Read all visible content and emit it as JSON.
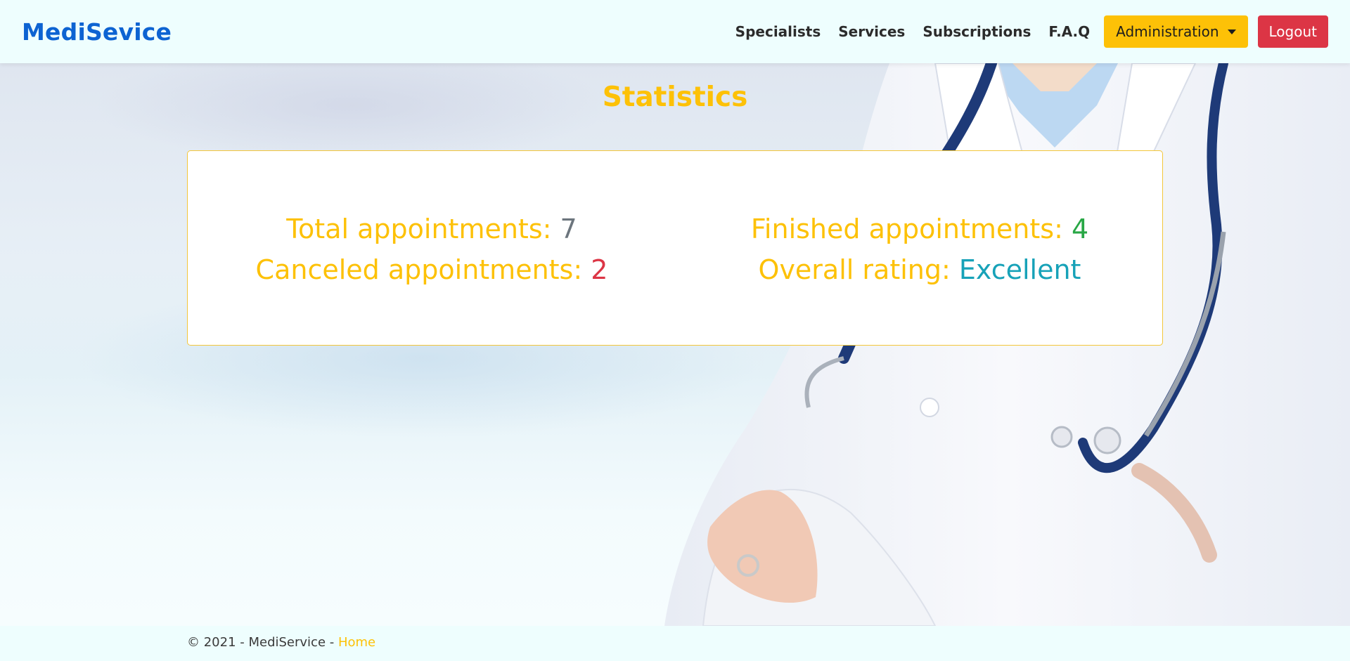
{
  "brand": {
    "name": "MediSevice"
  },
  "nav": {
    "links": [
      "Specialists",
      "Services",
      "Subscriptions",
      "F.A.Q"
    ],
    "admin_label": "Administration",
    "logout_label": "Logout"
  },
  "page": {
    "title": "Statistics"
  },
  "stats": {
    "total_label": "Total appointments: ",
    "total_value": "7",
    "canceled_label": "Canceled appointments: ",
    "canceled_value": "2",
    "finished_label": "Finished appointments: ",
    "finished_value": "4",
    "rating_label": "Overall rating: ",
    "rating_value": "Excellent"
  },
  "footer": {
    "text": "© 2021 - MediService - ",
    "link": "Home"
  },
  "colors": {
    "brand": "#0d63d2",
    "accent": "#fdc107",
    "danger": "#dc3545",
    "success": "#28a745",
    "info": "#17a2b8",
    "muted": "#6c757d"
  },
  "icons": {
    "dropdown": "caret-down-icon"
  }
}
